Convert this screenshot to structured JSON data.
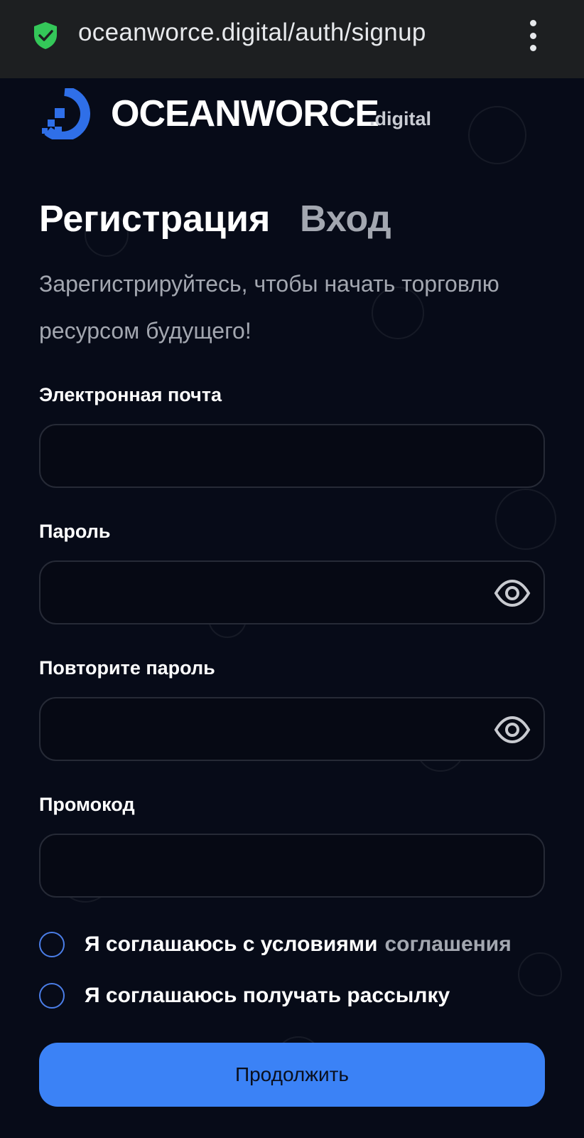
{
  "browser": {
    "url": "oceanworce.digital/auth/signup"
  },
  "logo": {
    "name": "OCEANWORCE",
    "suffix": ".digital"
  },
  "tabs": {
    "signup": "Регистрация",
    "login": "Вход"
  },
  "subtitle": "Зарегистрируйтесь, чтобы начать торговлю ресурсом будущего!",
  "form": {
    "email_label": "Электронная почта",
    "email_value": "",
    "password_label": "Пароль",
    "password_value": "",
    "repeat_password_label": "Повторите пароль",
    "repeat_password_value": "",
    "promo_label": "Промокод",
    "promo_value": ""
  },
  "agreements": {
    "terms_text": "Я соглашаюсь с условиями",
    "terms_link": "соглашения",
    "newsletter_text": "Я соглашаюсь получать рассылку"
  },
  "submit_label": "Продолжить",
  "colors": {
    "background": "#070b18",
    "accent": "#3b82f6",
    "secure": "#34c759"
  }
}
